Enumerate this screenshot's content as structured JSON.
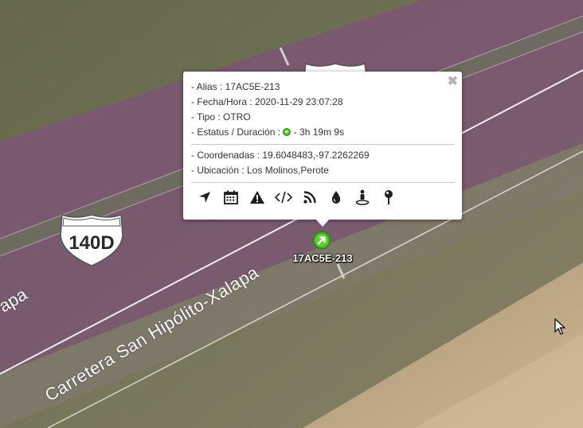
{
  "map": {
    "road_name": "Carretera San Hipólito-Xalapa",
    "road_name_fragment": "apa",
    "route_shield": "140D"
  },
  "vehicle": {
    "label": "17AC5E-213",
    "marker_color": "#4fc226"
  },
  "popup": {
    "alias": "- Alias : 17AC5E-213",
    "datetime": "- Fecha/Hora : 2020-11-29 23:07:28",
    "type": "- Tipo : OTRO",
    "status_prefix": "- Estatus / Duración :",
    "status_duration": "- 3h 19m 9s",
    "status_color": "#4fc226",
    "coordinates": "- Coordenadas : 19.6048483,-97.2262269",
    "location": "- Ubicación : Los Molinos,Perote",
    "close_glyph": "✖",
    "toolbar": [
      {
        "icon": "navigation-arrow-icon"
      },
      {
        "icon": "calendar-icon"
      },
      {
        "icon": "warning-icon"
      },
      {
        "icon": "code-icon"
      },
      {
        "icon": "rss-icon"
      },
      {
        "icon": "drop-icon"
      },
      {
        "icon": "street-view-icon"
      },
      {
        "icon": "map-pin-icon"
      }
    ]
  }
}
